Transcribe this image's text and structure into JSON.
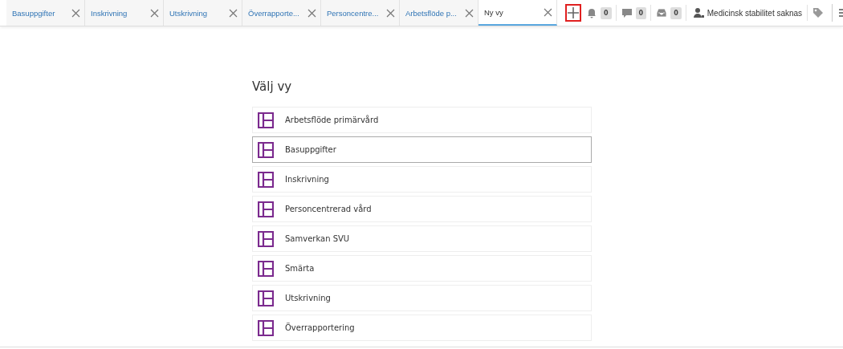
{
  "tabs": [
    {
      "label": "Basuppgifter",
      "selected": false
    },
    {
      "label": "Inskrivning",
      "selected": false
    },
    {
      "label": "Utskrivning",
      "selected": false
    },
    {
      "label": "Överrapporte...",
      "selected": false
    },
    {
      "label": "Personcentre...",
      "selected": false
    },
    {
      "label": "Arbetsflöde p...",
      "selected": false
    },
    {
      "label": "Ny vy",
      "selected": true
    }
  ],
  "add_tab": {
    "highlighted": true
  },
  "counters": [
    {
      "kind": "bell",
      "count": "0"
    },
    {
      "kind": "chat",
      "count": "0"
    },
    {
      "kind": "inbox",
      "count": "0"
    }
  ],
  "patient_status": "Medicinsk stabilitet saknas",
  "title": "Välj vy",
  "views": [
    {
      "label": "Arbetsflöde primärvård",
      "hovered": false
    },
    {
      "label": "Basuppgifter",
      "hovered": true
    },
    {
      "label": "Inskrivning",
      "hovered": false
    },
    {
      "label": "Personcentrerad vård",
      "hovered": false
    },
    {
      "label": "Samverkan SVU",
      "hovered": false
    },
    {
      "label": "Smärta",
      "hovered": false
    },
    {
      "label": "Utskrivning",
      "hovered": false
    },
    {
      "label": "Överrapportering",
      "hovered": false
    }
  ]
}
